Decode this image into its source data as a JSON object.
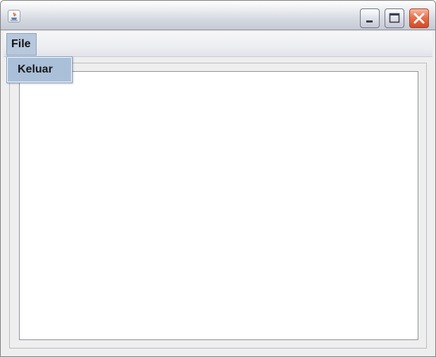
{
  "window": {
    "title": ""
  },
  "menubar": {
    "file_label": "File"
  },
  "file_menu": {
    "items": [
      {
        "label": "Keluar"
      }
    ]
  },
  "icons": {
    "app": "java-coffee-cup-icon",
    "minimize": "minimize-icon",
    "maximize": "maximize-icon",
    "close": "close-icon"
  },
  "colors": {
    "menu_highlight": "#b8c8dc",
    "item_highlight": "#aabfd8",
    "close_button": "#e9704c"
  }
}
